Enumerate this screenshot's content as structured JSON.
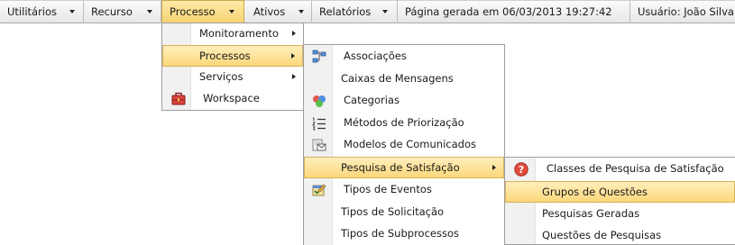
{
  "menubar": {
    "utilitarios": "Utilitários",
    "recurso": "Recurso",
    "processo": "Processo",
    "ativos": "Ativos",
    "relatorios": "Relatórios",
    "generated": "Página gerada em 06/03/2013 19:27:42",
    "user": "Usuário: João Silva"
  },
  "processo_menu": {
    "items": [
      "Monitoramento",
      "Processos",
      "Serviços",
      "Workspace"
    ]
  },
  "processos_menu": {
    "items": [
      "Associações",
      "Caixas de Mensagens",
      "Categorias",
      "Métodos de Priorização",
      "Modelos de Comunicados",
      "Pesquisa de Satisfação",
      "Tipos de Eventos",
      "Tipos de Solicitação",
      "Tipos de Subprocessos"
    ]
  },
  "pesquisa_menu": {
    "items": [
      "Classes de Pesquisa de Satisfação",
      "Grupos de Questões",
      "Pesquisas Geradas",
      "Questões de Pesquisas"
    ]
  },
  "colors": {
    "highlight": "#fbd77a",
    "border": "#9e9e9e"
  },
  "icons": [
    "workspace-toolbox-icon",
    "associations-icon",
    "categories-icon",
    "priority-list-icon",
    "communication-template-icon",
    "event-types-icon",
    "help-question-icon"
  ]
}
